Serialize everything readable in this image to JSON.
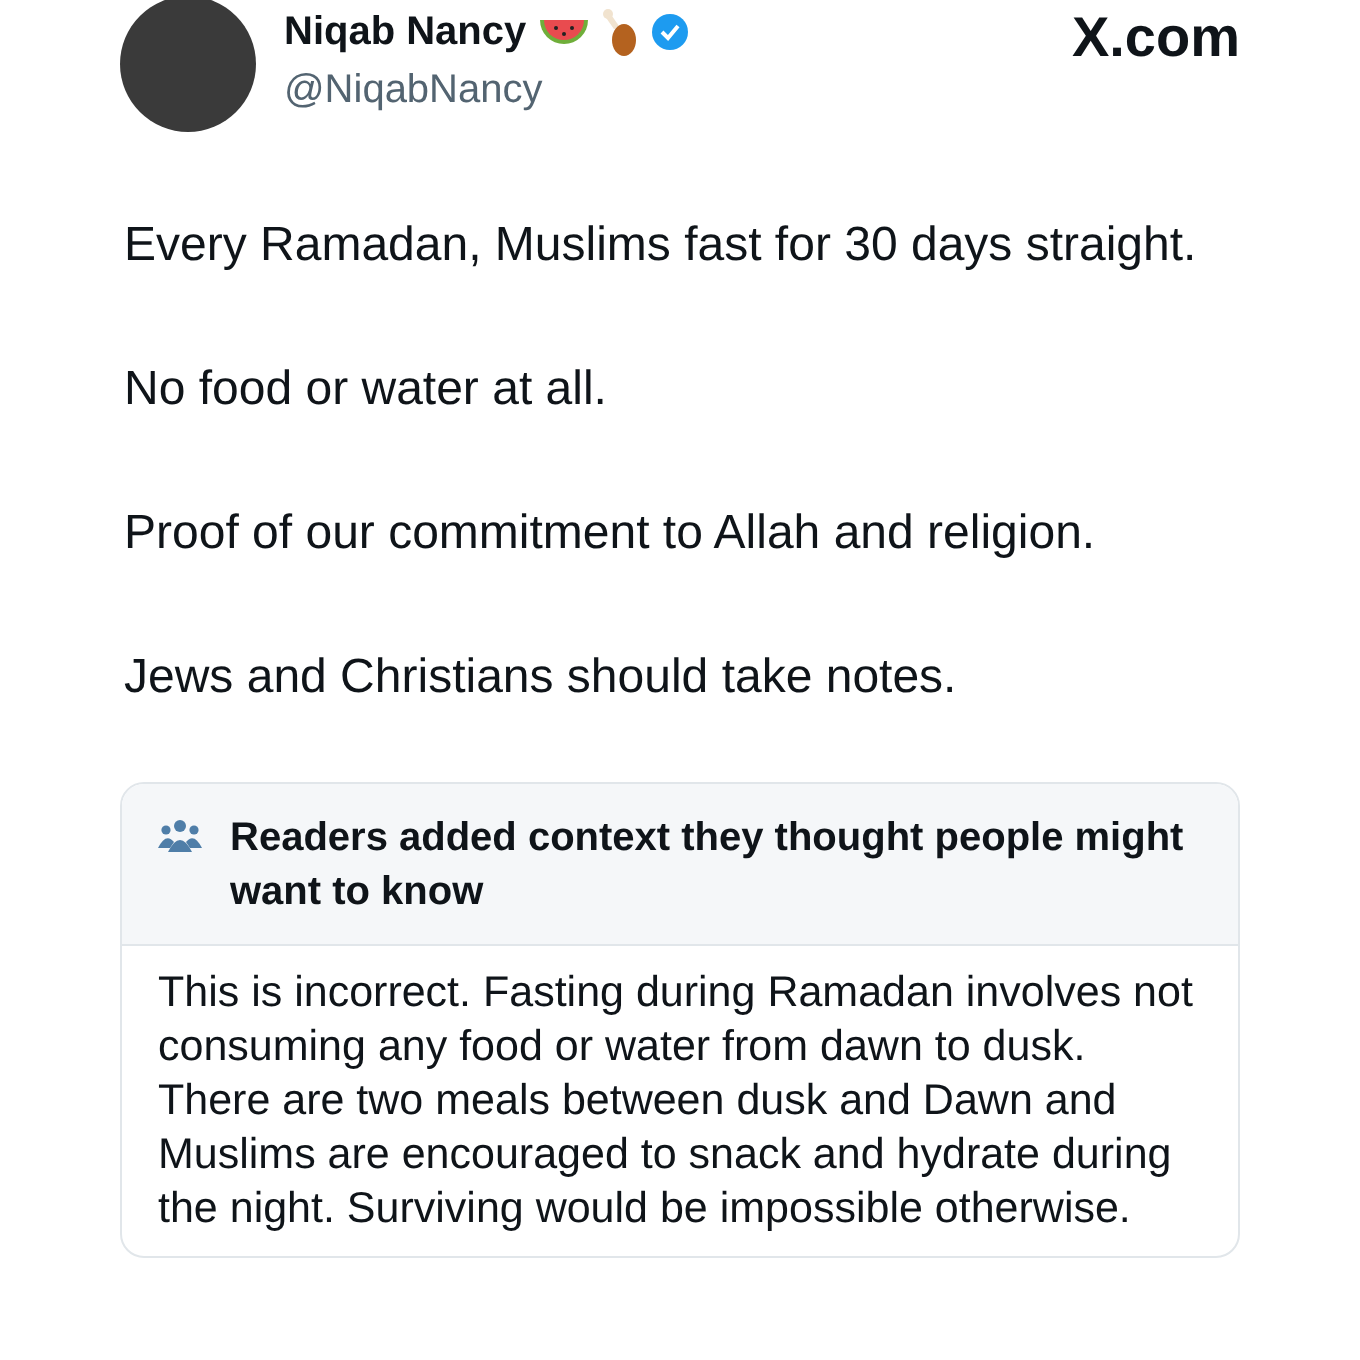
{
  "author": {
    "name": "Niqab Nancy",
    "handle": "@NiqabNancy",
    "verified": true
  },
  "site": "X.com",
  "tweet_paragraphs": [
    "Every Ramadan, Muslims fast for 30 days straight.",
    "No food or water at all.",
    "Proof of our commitment to Allah and religion.",
    "Jews and Christians should take notes."
  ],
  "community_note": {
    "title": "Readers added context they thought people might want to know",
    "body": "This is incorrect. Fasting during Ramadan involves not consuming any food or water from dawn to dusk. There are two meals between dusk and Dawn and Muslims are encouraged to snack and hydrate during the night. Surviving would be impossible otherwise."
  }
}
